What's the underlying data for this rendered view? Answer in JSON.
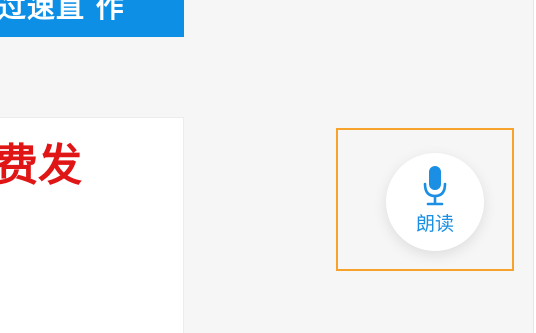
{
  "banner": {
    "text": "过速直 作",
    "background": "#0e8fe6"
  },
  "content": {
    "headline": "费发",
    "headline_color": "#e01515"
  },
  "read_aloud": {
    "label": "朗读",
    "icon": "microphone-icon",
    "color": "#1a8fe3",
    "highlight_color": "#f6a22b"
  }
}
